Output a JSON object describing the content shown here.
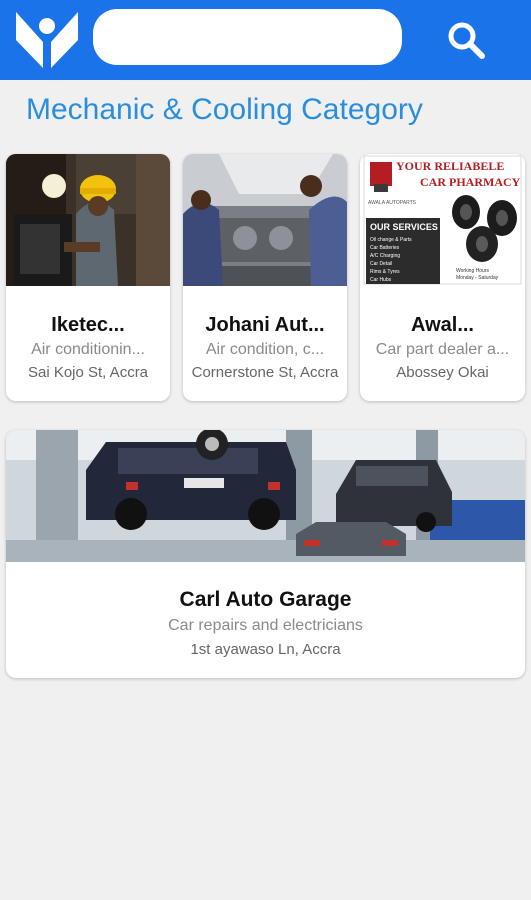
{
  "header": {
    "logo_icon": "brand-logo-icon",
    "search": {
      "value": "",
      "placeholder": ""
    },
    "search_icon": "search-icon",
    "color": "#1a73e8"
  },
  "category": {
    "title": "Mechanic & Cooling Category",
    "title_color": "#2a8ede"
  },
  "businesses": [
    {
      "name": "Iketec...",
      "description": "Air conditionin...",
      "address": "Sai Kojo St, Accra"
    },
    {
      "name": "Johani Aut...",
      "description": "Air condition, c...",
      "address": "Cornerstone St, Accra"
    },
    {
      "name": "Awal...",
      "description": "Car part dealer a...",
      "address": "Abossey Okai"
    }
  ],
  "featured": {
    "name": "Carl Auto Garage",
    "description": "Car repairs and electricians",
    "address": "1st ayawaso Ln, Accra"
  },
  "poster": {
    "headline_1": "YOUR RELIABELE",
    "headline_2": "CAR PHARMACY",
    "company": "AWALA AUTOPARTS",
    "services_heading": "OUR SERVICES",
    "services": [
      "Oil change & Parts",
      "Car Batteries",
      "A/C Charging",
      "Car Detail",
      "Rims & Tyres",
      "Car Hubs"
    ],
    "hours_label": "Working Hours",
    "hours_value": "Monday - Saturday"
  }
}
